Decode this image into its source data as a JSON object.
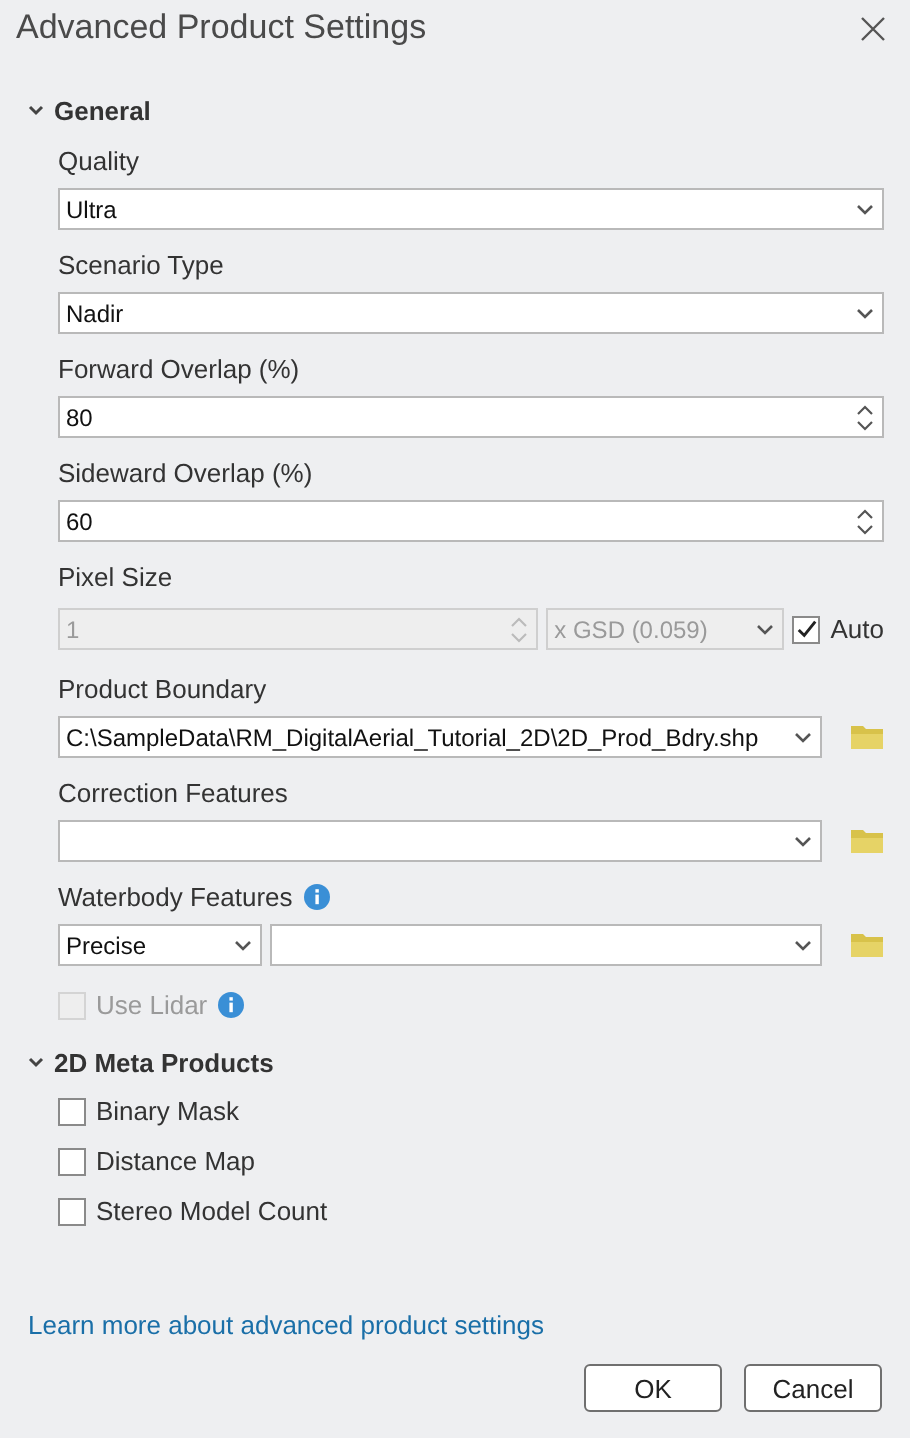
{
  "window": {
    "title": "Advanced Product Settings"
  },
  "sections": [
    {
      "title": "General",
      "expanded": true,
      "fields": [
        {
          "kind": "dropdown",
          "label": "Quality",
          "value": "Ultra"
        },
        {
          "kind": "dropdown",
          "label": "Scenario Type",
          "value": "Nadir"
        },
        {
          "kind": "spinner",
          "label": "Forward Overlap (%)",
          "value": "80"
        },
        {
          "kind": "spinner",
          "label": "Sideward Overlap (%)",
          "value": "60"
        },
        {
          "kind": "pixel_size",
          "label": "Pixel Size",
          "value": "1",
          "unit": "x GSD (0.059)",
          "disabled": true,
          "auto": {
            "label": "Auto",
            "checked": true
          }
        },
        {
          "kind": "dropdown_browse",
          "label": "Product Boundary",
          "value": "C:\\SampleData\\RM_DigitalAerial_Tutorial_2D\\2D_Prod_Bdry.shp"
        },
        {
          "kind": "dropdown_browse",
          "label": "Correction Features"
        },
        {
          "kind": "split_browse",
          "label": "Waterbody Features",
          "info": true,
          "mode": "Precise"
        },
        {
          "kind": "checkbox",
          "label": "Use Lidar",
          "checked": false,
          "disabled": true,
          "info": true
        }
      ]
    },
    {
      "title": "2D Meta Products",
      "expanded": true,
      "fields": [
        {
          "kind": "checkbox",
          "label": "Binary Mask",
          "checked": false,
          "disabled": false
        },
        {
          "kind": "checkbox",
          "label": "Distance Map",
          "checked": false,
          "disabled": false
        },
        {
          "kind": "checkbox",
          "label": "Stereo Model Count",
          "checked": false,
          "disabled": false
        }
      ]
    }
  ],
  "link": "Learn more about advanced product settings",
  "buttons": [
    "OK",
    "Cancel"
  ]
}
